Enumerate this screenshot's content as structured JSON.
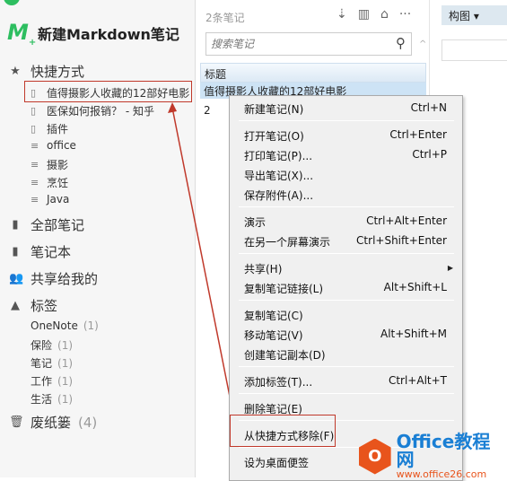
{
  "sidebar": {
    "new_markdown": "新建Markdown笔记",
    "shortcuts": "快捷方式",
    "shortcut_items": [
      {
        "label": "值得摄影人收藏的12部好电影",
        "icon": "note-icon"
      },
      {
        "label": "医保如何报销？ - 知乎",
        "icon": "note-icon"
      },
      {
        "label": "插件",
        "icon": "notebook-icon"
      },
      {
        "label": "office",
        "icon": "tag-list-icon"
      },
      {
        "label": "摄影",
        "icon": "tag-list-icon"
      },
      {
        "label": "烹饪",
        "icon": "tag-list-icon"
      },
      {
        "label": "Java",
        "icon": "tag-list-icon"
      }
    ],
    "all_notes": "全部笔记",
    "notebooks": "笔记本",
    "shared": "共享给我的",
    "tags": "标签",
    "tag_items": [
      {
        "label": "OneNote",
        "count": "(1)"
      },
      {
        "label": "保险",
        "count": "(1)"
      },
      {
        "label": "笔记",
        "count": "(1)"
      },
      {
        "label": "工作",
        "count": "(1)"
      },
      {
        "label": "生活",
        "count": "(1)"
      }
    ],
    "trash": "废纸篓",
    "trash_count": "(4)"
  },
  "list": {
    "count": "2条笔记",
    "search_placeholder": "搜索笔记",
    "column_title": "标题",
    "rows": [
      "值得摄影人收藏的12部好电影",
      "2"
    ]
  },
  "right": {
    "view_label": "构图 ▾"
  },
  "menu": [
    {
      "label": "新建笔记(N)",
      "shortcut": "Ctrl+N"
    },
    {
      "label": "打开笔记(O)",
      "shortcut": "Ctrl+Enter"
    },
    {
      "label": "打印笔记(P)...",
      "shortcut": "Ctrl+P"
    },
    {
      "label": "导出笔记(X)...",
      "shortcut": ""
    },
    {
      "label": "保存附件(A)...",
      "shortcut": ""
    },
    {
      "label": "演示",
      "shortcut": "Ctrl+Alt+Enter"
    },
    {
      "label": "在另一个屏幕演示",
      "shortcut": "Ctrl+Shift+Enter"
    },
    {
      "label": "共享(H)",
      "shortcut": ""
    },
    {
      "label": "复制笔记链接(L)",
      "shortcut": "Alt+Shift+L"
    },
    {
      "label": "复制笔记(C)",
      "shortcut": ""
    },
    {
      "label": "移动笔记(V)",
      "shortcut": "Alt+Shift+M"
    },
    {
      "label": "创建笔记副本(D)",
      "shortcut": ""
    },
    {
      "label": "添加标签(T)...",
      "shortcut": "Ctrl+Alt+T"
    },
    {
      "label": "删除笔记(E)",
      "shortcut": ""
    },
    {
      "label": "从快捷方式移除(F)",
      "shortcut": ""
    },
    {
      "label": "设为桌面便签",
      "shortcut": ""
    }
  ],
  "watermark": {
    "brand": "Office教程网",
    "url": "www.office26.com"
  },
  "colors": {
    "accent": "#2dbe60",
    "highlight": "#c0392b",
    "selection": "#cde3f5"
  }
}
